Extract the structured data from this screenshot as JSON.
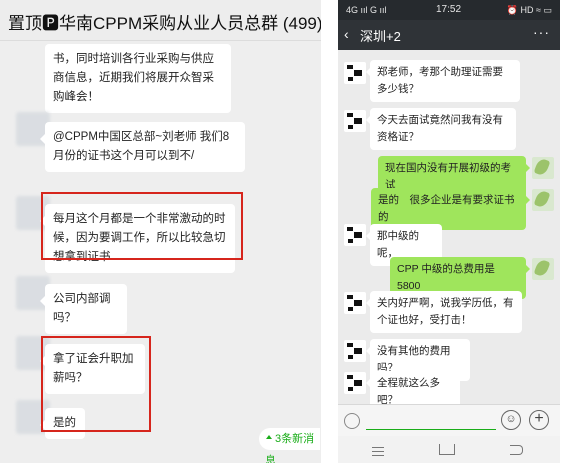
{
  "left_chat": {
    "title": "置顶🅿华南CPPM采购从业人员总群 (499)",
    "messages": [
      {
        "text": "书，同时培训各行业采购与供应商信息，近期我们将展开众智采购峰会！"
      },
      {
        "text": "@CPPM中国区总部~刘老师 我们8月份的证书这个月可以到不/"
      },
      {
        "text": "每月这个月都是一个非常激动的时候，因为要调工作，所以比较急切想拿到证书"
      },
      {
        "text": "公司内部调 吗？"
      },
      {
        "text": "拿了证会升职加薪吗？"
      },
      {
        "text": "是的"
      }
    ],
    "new_messages": "3条新消息"
  },
  "right_chat": {
    "status": {
      "signal": "4G ııl G ııl",
      "time": "17:52",
      "icons": "⏰ HD ≈ ▭"
    },
    "title": "深圳+2",
    "back": "‹",
    "more": "···",
    "messages": [
      {
        "from": "other",
        "text": "郑老师，考那个助理证需要多少钱？"
      },
      {
        "from": "other",
        "text": "今天去面试竟然问我有没有资格证？"
      },
      {
        "from": "me",
        "text": "现在国内没有开展初级的考试"
      },
      {
        "from": "me",
        "text": "是的　很多企业是有要求证书的"
      },
      {
        "from": "other",
        "text": "那中级的呢，"
      },
      {
        "from": "me",
        "text": "CPP 中级的总费用是 5800"
      },
      {
        "from": "other",
        "text": "关内好严啊，说我学历低，有个证也好，受打击！"
      },
      {
        "from": "other",
        "text": "没有其他的费用吗？"
      },
      {
        "from": "other",
        "text": "全程就这么多吧？"
      }
    ],
    "input_buttons": {
      "emoji": "☺",
      "plus": "+"
    }
  }
}
